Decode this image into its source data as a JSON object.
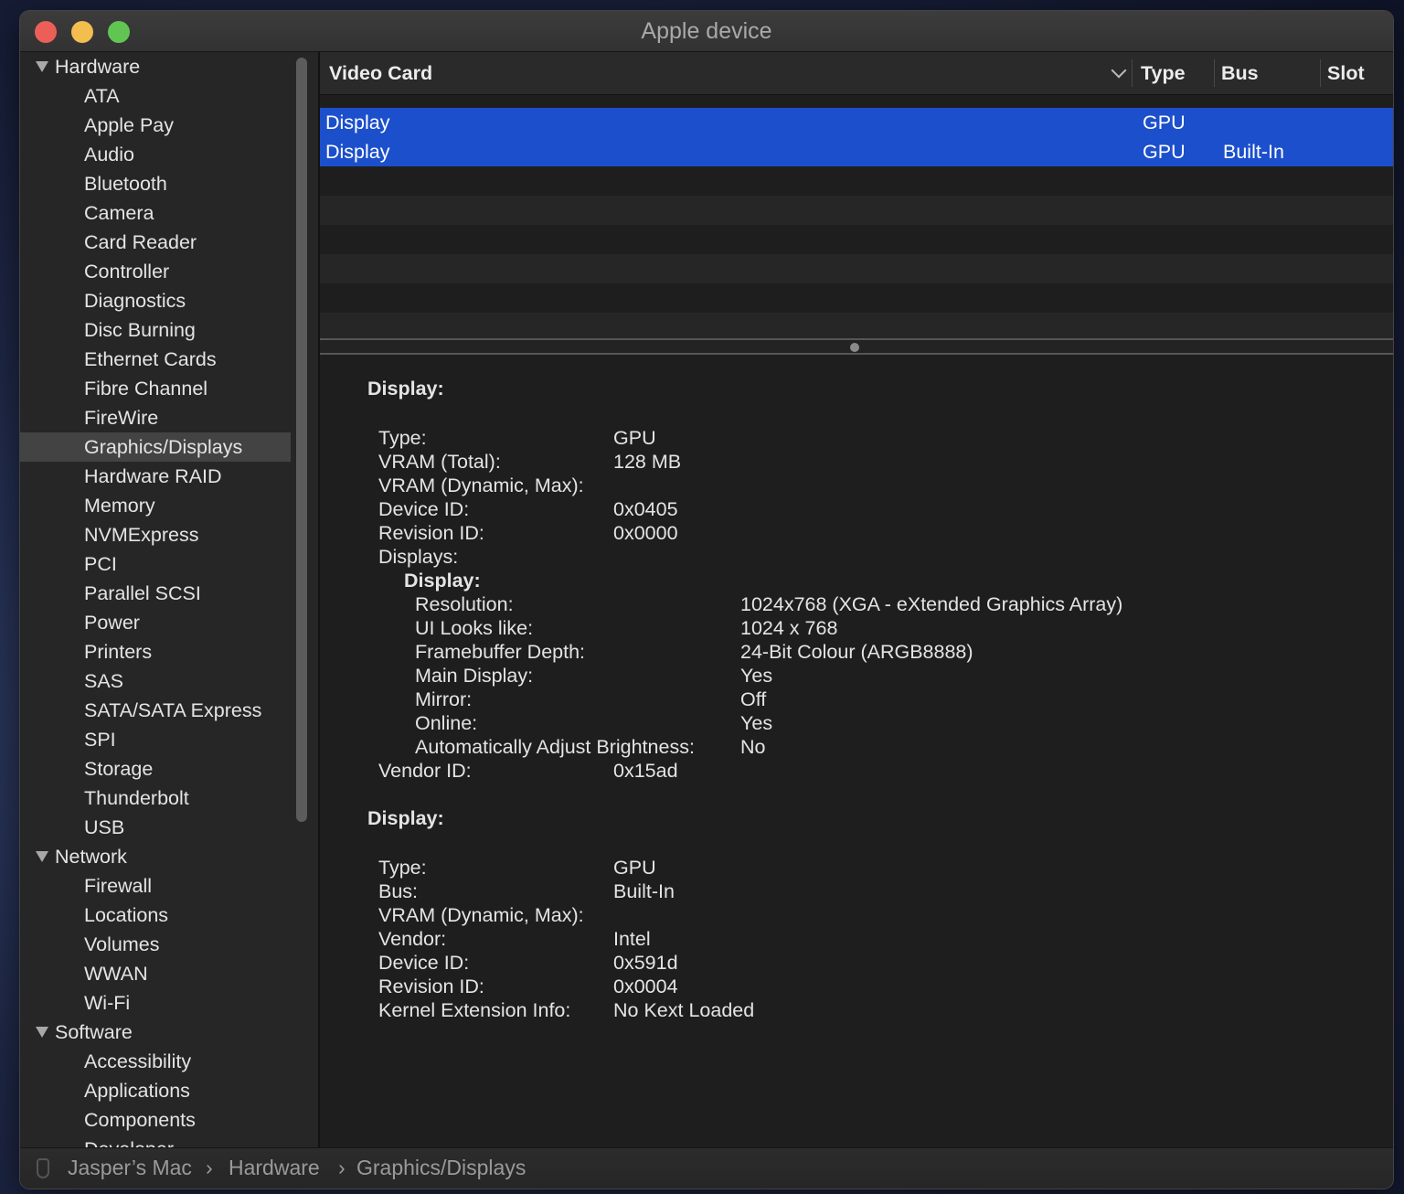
{
  "window": {
    "title": "Apple device"
  },
  "sidebar": {
    "groups": [
      {
        "label": "Hardware",
        "items": [
          "ATA",
          "Apple Pay",
          "Audio",
          "Bluetooth",
          "Camera",
          "Card Reader",
          "Controller",
          "Diagnostics",
          "Disc Burning",
          "Ethernet Cards",
          "Fibre Channel",
          "FireWire",
          "Graphics/Displays",
          "Hardware RAID",
          "Memory",
          "NVMExpress",
          "PCI",
          "Parallel SCSI",
          "Power",
          "Printers",
          "SAS",
          "SATA/SATA Express",
          "SPI",
          "Storage",
          "Thunderbolt",
          "USB"
        ]
      },
      {
        "label": "Network",
        "items": [
          "Firewall",
          "Locations",
          "Volumes",
          "WWAN",
          "Wi-Fi"
        ]
      },
      {
        "label": "Software",
        "items": [
          "Accessibility",
          "Applications",
          "Components",
          "Developer"
        ]
      }
    ],
    "selected": "Graphics/Displays"
  },
  "table": {
    "columns": [
      "Video Card",
      "Type",
      "Bus",
      "Slot"
    ],
    "rows": [
      {
        "name": "Display",
        "type": "GPU",
        "bus": "",
        "slot": ""
      },
      {
        "name": "Display",
        "type": "GPU",
        "bus": "Built-In",
        "slot": ""
      }
    ]
  },
  "detail": {
    "sections": [
      {
        "title": "Display:",
        "fields": [
          {
            "k": "Type:",
            "v": "GPU"
          },
          {
            "k": "VRAM (Total):",
            "v": "128 MB"
          },
          {
            "k": "VRAM (Dynamic, Max):",
            "v": ""
          },
          {
            "k": "Device ID:",
            "v": "0x0405"
          },
          {
            "k": "Revision ID:",
            "v": "0x0000"
          },
          {
            "k": "Displays:",
            "v": ""
          }
        ],
        "subsection": {
          "title": "Display:",
          "fields": [
            {
              "k": "Resolution:",
              "v": "1024x768 (XGA - eXtended Graphics Array)"
            },
            {
              "k": "UI Looks like:",
              "v": "1024 x 768"
            },
            {
              "k": "Framebuffer Depth:",
              "v": "24-Bit Colour (ARGB8888)"
            },
            {
              "k": "Main Display:",
              "v": "Yes"
            },
            {
              "k": "Mirror:",
              "v": "Off"
            },
            {
              "k": "Online:",
              "v": "Yes"
            },
            {
              "k": "Automatically Adjust Brightness:",
              "v": "No"
            }
          ]
        },
        "trailing": [
          {
            "k": "Vendor ID:",
            "v": "0x15ad"
          }
        ]
      },
      {
        "title": "Display:",
        "fields": [
          {
            "k": "Type:",
            "v": "GPU"
          },
          {
            "k": "Bus:",
            "v": "Built-In"
          },
          {
            "k": "VRAM (Dynamic, Max):",
            "v": ""
          },
          {
            "k": "Vendor:",
            "v": "Intel"
          },
          {
            "k": "Device ID:",
            "v": "0x591d"
          },
          {
            "k": "Revision ID:",
            "v": "0x0004"
          },
          {
            "k": "Kernel Extension Info:",
            "v": "No Kext Loaded"
          }
        ]
      }
    ]
  },
  "breadcrumb": [
    "Jasper’s Mac",
    "›",
    "Hardware",
    "›",
    "Graphics/Displays"
  ],
  "colors": {
    "selection": "#1c4fcb",
    "close": "#ec5f57",
    "minimize": "#f3bd4f",
    "zoom": "#61c554"
  }
}
